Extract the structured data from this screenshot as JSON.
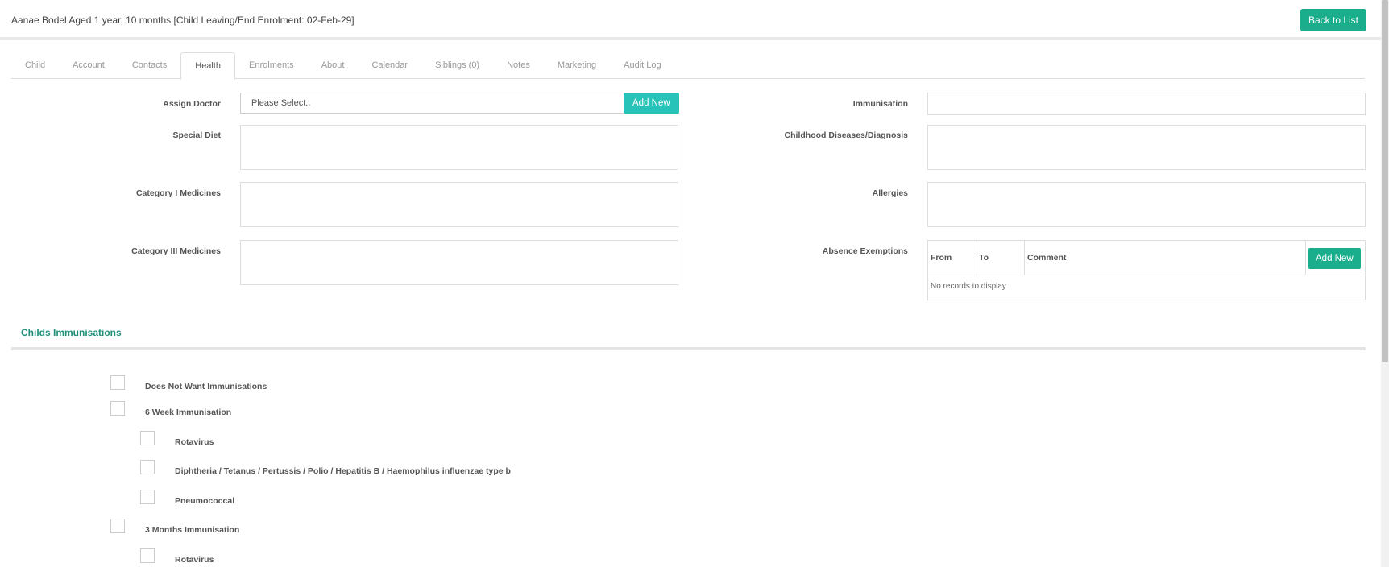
{
  "header": {
    "title": "Aanae Bodel Aged 1 year, 10 months [Child Leaving/End Enrolment: 02-Feb-29]",
    "back_label": "Back to List"
  },
  "tabs": [
    {
      "label": "Child"
    },
    {
      "label": "Account"
    },
    {
      "label": "Contacts"
    },
    {
      "label": "Health",
      "active": true
    },
    {
      "label": "Enrolments"
    },
    {
      "label": "About"
    },
    {
      "label": "Calendar"
    },
    {
      "label": "Siblings (0)"
    },
    {
      "label": "Notes"
    },
    {
      "label": "Marketing"
    },
    {
      "label": "Audit Log"
    }
  ],
  "form": {
    "assign_doctor_label": "Assign Doctor",
    "assign_doctor_value": "Please Select..",
    "add_new_label": "Add New",
    "immunisation_label": "Immunisation",
    "immunisation_value": "",
    "special_diet_label": "Special Diet",
    "childhood_diseases_label": "Childhood Diseases/Diagnosis",
    "cat1_label": "Category I Medicines",
    "allergies_label": "Allergies",
    "cat3_label": "Category III Medicines",
    "absence_label": "Absence Exemptions"
  },
  "absence_table": {
    "columns": [
      "From",
      "To",
      "Comment"
    ],
    "add_new_label": "Add New",
    "empty_text": "No records to display"
  },
  "immunisations": {
    "title": "Childs Immunisations",
    "items": [
      {
        "label": "Does Not Want Immunisations",
        "level": 0
      },
      {
        "label": "6 Week Immunisation",
        "level": 0
      },
      {
        "label": "Rotavirus",
        "level": 1
      },
      {
        "label": "Diphtheria / Tetanus / Pertussis / Polio / Hepatitis B / Haemophilus influenzae type b",
        "level": 1
      },
      {
        "label": "Pneumococcal",
        "level": 1
      },
      {
        "label": "3 Months Immunisation",
        "level": 0
      },
      {
        "label": "Rotavirus",
        "level": 1
      }
    ]
  },
  "colors": {
    "accent_green": "#1bae8c",
    "accent_teal": "#27c2b8",
    "section_title": "#1f8f7a"
  },
  "icons": {
    "select_arrow": "chevron-down-icon"
  }
}
